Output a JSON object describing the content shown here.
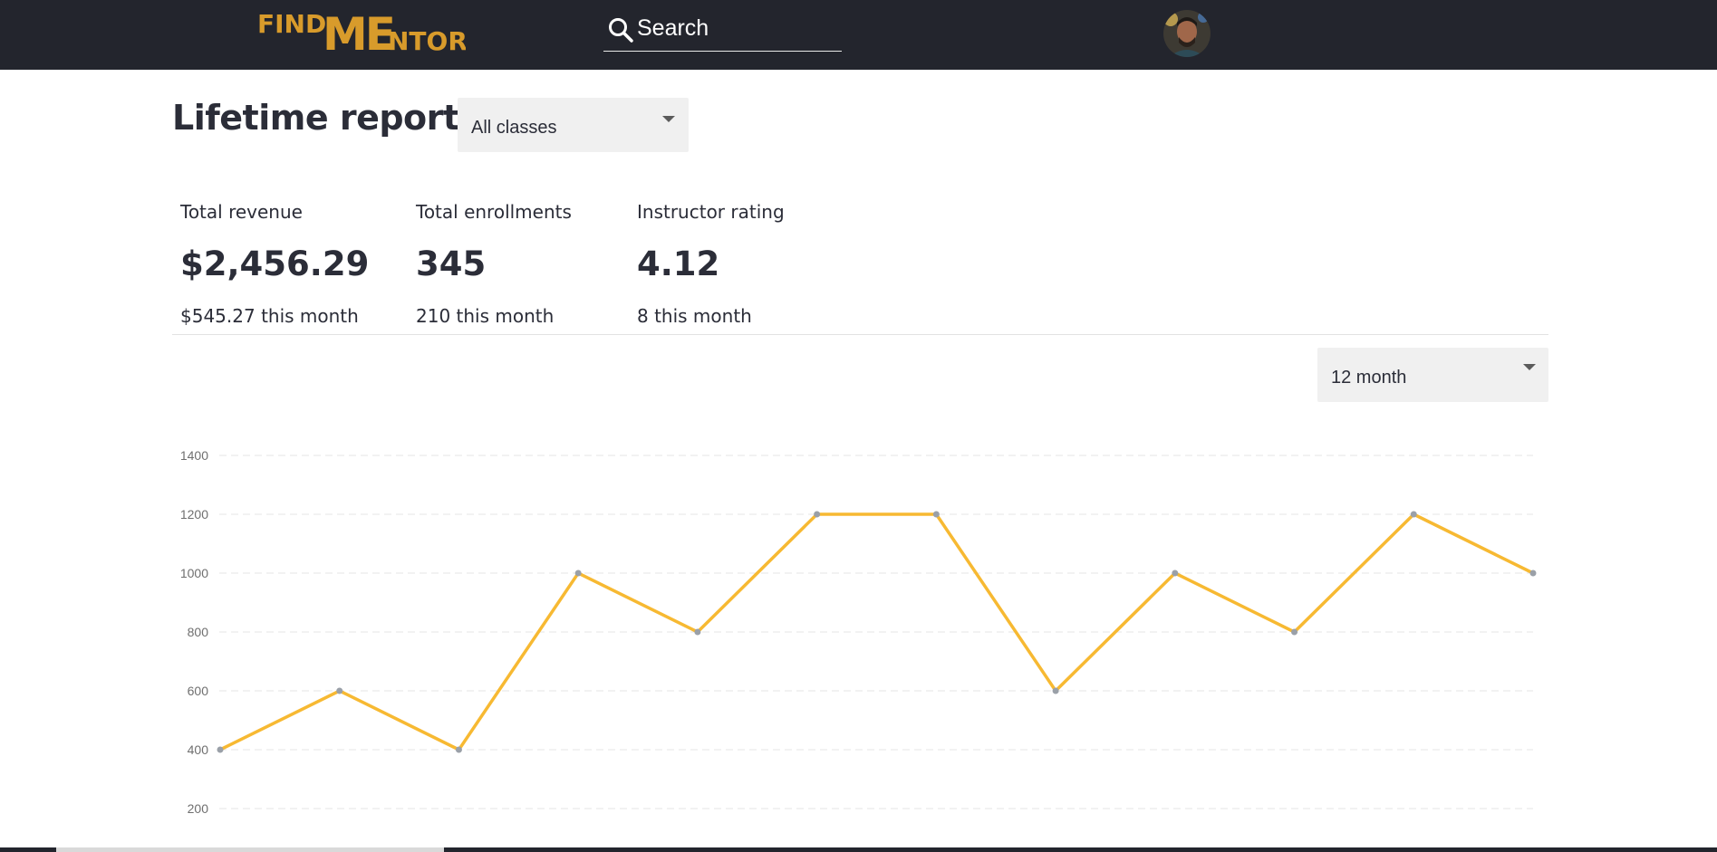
{
  "navbar": {
    "logo_text": "FINDMENTOR",
    "search": {
      "label": "Search",
      "icon": "search-icon"
    },
    "avatar": {
      "icon": "user-avatar"
    }
  },
  "header": {
    "title": "Lifetime report",
    "class_filter": {
      "selected": "All classes"
    }
  },
  "stats": [
    {
      "label": "Total revenue",
      "value": "$2,456.29",
      "sub": "$545.27 this month"
    },
    {
      "label": "Total enrollments",
      "value": "345",
      "sub": "210 this month"
    },
    {
      "label": "Instructor rating",
      "value": "4.12",
      "sub": "8 this month"
    }
  ],
  "period_filter": {
    "selected": "12 month"
  },
  "colors": {
    "navbar": "#23252d",
    "accent": "#f7b932",
    "logo": "#d89b2b",
    "point": "#9aa0a8"
  },
  "chart_data": {
    "type": "line",
    "x": [
      1,
      2,
      3,
      4,
      5,
      6,
      7,
      8,
      9,
      10,
      11,
      12
    ],
    "series": [
      {
        "values": [
          400,
          600,
          400,
          1000,
          800,
          1200,
          1200,
          600,
          1000,
          800,
          1200,
          1000
        ]
      }
    ],
    "yticks": [
      "200",
      "400",
      "600",
      "800",
      "1000",
      "1200",
      "1400"
    ],
    "ylim": [
      200,
      1400
    ],
    "grid": true,
    "title": "",
    "xlabel": "",
    "ylabel": ""
  }
}
